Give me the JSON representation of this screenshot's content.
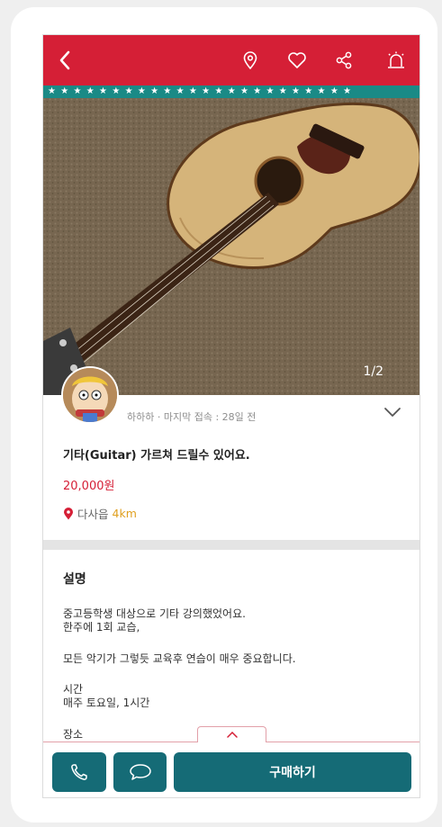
{
  "listing": {
    "image_counter": "1/2",
    "seller_info": "하하하 · 마지막 접속 : 28일 전",
    "title": "기타(Guitar) 가르쳐 드릴수 있어요.",
    "price": "20,000원",
    "location": "다사읍",
    "distance": "4km"
  },
  "description": {
    "heading": "설명",
    "lines": [
      "중고등학생 대상으로 기타 강의했었어요.",
      "한주에 1회 교습,",
      "모든 악기가 그렇듯 교육후 연습이 매우 중요합니다.",
      "시간",
      "매주 토요일, 1시간",
      "장소"
    ]
  },
  "actions": {
    "buy_label": "구매하기"
  },
  "colors": {
    "brand_red": "#d51f36",
    "teal": "#156b76",
    "distance_yellow": "#e0a020"
  },
  "icons": [
    "back-icon",
    "location-pin-icon",
    "heart-icon",
    "share-icon",
    "alarm-icon",
    "chevron-down-icon",
    "chevron-up-icon",
    "phone-icon",
    "chat-icon"
  ]
}
